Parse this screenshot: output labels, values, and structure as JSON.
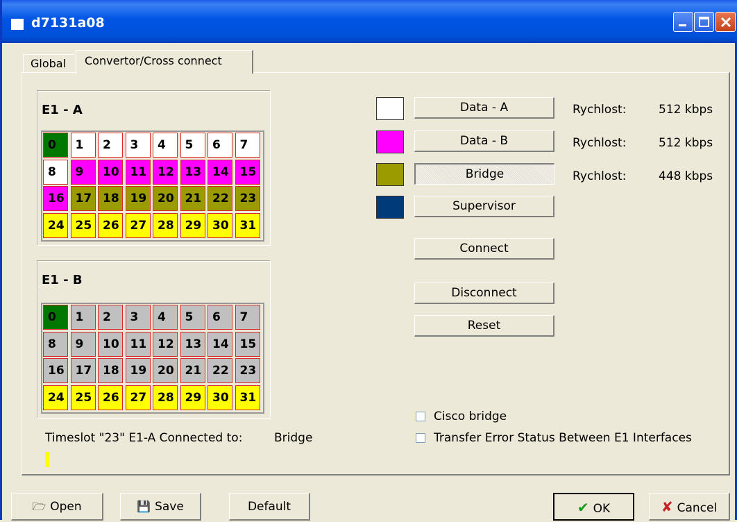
{
  "window": {
    "title": "d7131a08"
  },
  "tabs": [
    {
      "label": "Global"
    },
    {
      "label": "Convertor/Cross connect"
    }
  ],
  "e1a": {
    "title": "E1 - A",
    "cells": [
      {
        "n": "0",
        "c": "green"
      },
      {
        "n": "1",
        "c": "white"
      },
      {
        "n": "2",
        "c": "white"
      },
      {
        "n": "3",
        "c": "white"
      },
      {
        "n": "4",
        "c": "white"
      },
      {
        "n": "5",
        "c": "white"
      },
      {
        "n": "6",
        "c": "white"
      },
      {
        "n": "7",
        "c": "white"
      },
      {
        "n": "8",
        "c": "white"
      },
      {
        "n": "9",
        "c": "magenta"
      },
      {
        "n": "10",
        "c": "magenta"
      },
      {
        "n": "11",
        "c": "magenta"
      },
      {
        "n": "12",
        "c": "magenta"
      },
      {
        "n": "13",
        "c": "magenta"
      },
      {
        "n": "14",
        "c": "magenta"
      },
      {
        "n": "15",
        "c": "magenta"
      },
      {
        "n": "16",
        "c": "magenta"
      },
      {
        "n": "17",
        "c": "olive"
      },
      {
        "n": "18",
        "c": "olive"
      },
      {
        "n": "19",
        "c": "olive"
      },
      {
        "n": "20",
        "c": "olive"
      },
      {
        "n": "21",
        "c": "olive"
      },
      {
        "n": "22",
        "c": "olive"
      },
      {
        "n": "23",
        "c": "olive"
      },
      {
        "n": "24",
        "c": "yellow"
      },
      {
        "n": "25",
        "c": "yellow"
      },
      {
        "n": "26",
        "c": "yellow"
      },
      {
        "n": "27",
        "c": "yellow"
      },
      {
        "n": "28",
        "c": "yellow"
      },
      {
        "n": "29",
        "c": "yellow"
      },
      {
        "n": "30",
        "c": "yellow"
      },
      {
        "n": "31",
        "c": "yellow"
      }
    ]
  },
  "e1b": {
    "title": "E1 - B",
    "cells": [
      {
        "n": "0",
        "c": "green"
      },
      {
        "n": "1",
        "c": "gray"
      },
      {
        "n": "2",
        "c": "gray"
      },
      {
        "n": "3",
        "c": "gray"
      },
      {
        "n": "4",
        "c": "gray"
      },
      {
        "n": "5",
        "c": "gray"
      },
      {
        "n": "6",
        "c": "gray"
      },
      {
        "n": "7",
        "c": "gray"
      },
      {
        "n": "8",
        "c": "gray"
      },
      {
        "n": "9",
        "c": "gray"
      },
      {
        "n": "10",
        "c": "gray"
      },
      {
        "n": "11",
        "c": "gray"
      },
      {
        "n": "12",
        "c": "gray"
      },
      {
        "n": "13",
        "c": "gray"
      },
      {
        "n": "14",
        "c": "gray"
      },
      {
        "n": "15",
        "c": "gray"
      },
      {
        "n": "16",
        "c": "gray"
      },
      {
        "n": "17",
        "c": "gray"
      },
      {
        "n": "18",
        "c": "gray"
      },
      {
        "n": "19",
        "c": "gray"
      },
      {
        "n": "20",
        "c": "gray"
      },
      {
        "n": "21",
        "c": "gray"
      },
      {
        "n": "22",
        "c": "gray"
      },
      {
        "n": "23",
        "c": "gray"
      },
      {
        "n": "24",
        "c": "yellow"
      },
      {
        "n": "25",
        "c": "yellow"
      },
      {
        "n": "26",
        "c": "yellow"
      },
      {
        "n": "27",
        "c": "yellow"
      },
      {
        "n": "28",
        "c": "yellow"
      },
      {
        "n": "29",
        "c": "yellow"
      },
      {
        "n": "30",
        "c": "yellow"
      },
      {
        "n": "31",
        "c": "yellow"
      }
    ]
  },
  "colors": {
    "green": "#007800",
    "white": "#ffffff",
    "magenta": "#ff00ff",
    "olive": "#9b9b00",
    "yellow": "#ffff00",
    "gray": "#c0c0c0",
    "navy": "#003a78"
  },
  "channels": [
    {
      "color": "#ffffff",
      "label": "Data - A",
      "rate_label": "Rychlost:",
      "rate": "512 kbps"
    },
    {
      "color": "#ff00ff",
      "label": "Data - B",
      "rate_label": "Rychlost:",
      "rate": "512 kbps"
    },
    {
      "color": "#9b9b00",
      "label": "Bridge",
      "rate_label": "Rychlost:",
      "rate": "448 kbps",
      "pressed": true
    },
    {
      "color": "#003a78",
      "label": "Supervisor"
    }
  ],
  "actions": {
    "connect": "Connect",
    "disconnect": "Disconnect",
    "reset": "Reset"
  },
  "options": {
    "cisco_bridge": "Cisco bridge",
    "transfer_error": "Transfer Error Status Between E1 Interfaces"
  },
  "status": {
    "text": "Timeslot \"23\" E1-A Connected to:",
    "value": "Bridge",
    "indicator_color": "#ffff00"
  },
  "bottom": {
    "open": "Open",
    "save": "Save",
    "default": "Default",
    "ok": "OK",
    "cancel": "Cancel"
  }
}
